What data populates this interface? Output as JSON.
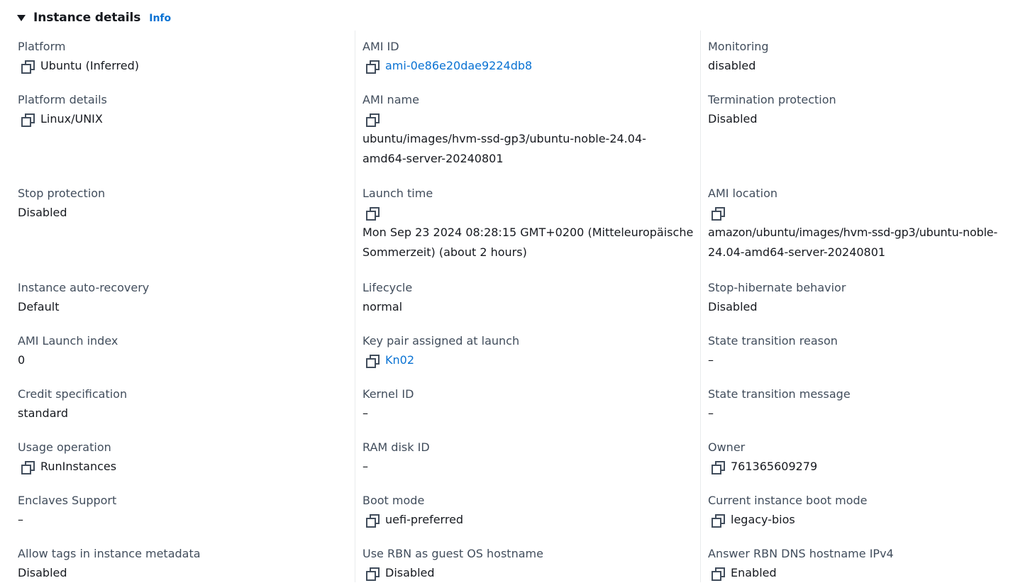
{
  "header": {
    "title": "Instance details",
    "info_link": "Info"
  },
  "col1": {
    "platform": {
      "label": "Platform",
      "value": "Ubuntu (Inferred)"
    },
    "platform_details": {
      "label": "Platform details",
      "value": "Linux/UNIX"
    },
    "stop_protection": {
      "label": "Stop protection",
      "value": "Disabled"
    },
    "auto_recovery": {
      "label": "Instance auto-recovery",
      "value": "Default"
    },
    "ami_launch_index": {
      "label": "AMI Launch index",
      "value": "0"
    },
    "credit_spec": {
      "label": "Credit specification",
      "value": "standard"
    },
    "usage_operation": {
      "label": "Usage operation",
      "value": "RunInstances"
    },
    "enclaves": {
      "label": "Enclaves Support",
      "value": "–"
    },
    "allow_tags": {
      "label": "Allow tags in instance metadata",
      "value": "Disabled"
    }
  },
  "col2": {
    "ami_id": {
      "label": "AMI ID",
      "value": "ami-0e86e20dae9224db8"
    },
    "ami_name": {
      "label": "AMI name",
      "line1": "ubuntu/images/hvm-ssd-gp3/ubuntu-noble-24.04-",
      "line2": "amd64-server-20240801"
    },
    "launch_time": {
      "label": "Launch time",
      "line1": "Mon Sep 23 2024 08:28:15 GMT+0200 (Mitteleuropäische",
      "line2": "Sommerzeit) (about 2 hours)"
    },
    "lifecycle": {
      "label": "Lifecycle",
      "value": "normal"
    },
    "key_pair": {
      "label": "Key pair assigned at launch",
      "value": "Kn02"
    },
    "kernel_id": {
      "label": "Kernel ID",
      "value": "–"
    },
    "ram_disk_id": {
      "label": "RAM disk ID",
      "value": "–"
    },
    "boot_mode": {
      "label": "Boot mode",
      "value": "uefi-preferred"
    },
    "rbn_hostname": {
      "label": "Use RBN as guest OS hostname",
      "value": "Disabled"
    }
  },
  "col3": {
    "monitoring": {
      "label": "Monitoring",
      "value": "disabled"
    },
    "termination_protection": {
      "label": "Termination protection",
      "value": "Disabled"
    },
    "ami_location": {
      "label": "AMI location",
      "line1": "amazon/ubuntu/images/hvm-ssd-gp3/ubuntu-noble-",
      "line2": "24.04-amd64-server-20240801"
    },
    "stop_hibernate": {
      "label": "Stop-hibernate behavior",
      "value": "Disabled"
    },
    "state_reason": {
      "label": "State transition reason",
      "value": "–"
    },
    "state_message": {
      "label": "State transition message",
      "value": "–"
    },
    "owner": {
      "label": "Owner",
      "value": "761365609279"
    },
    "current_boot_mode": {
      "label": "Current instance boot mode",
      "value": "legacy-bios"
    },
    "rbn_dns_ipv4": {
      "label": "Answer RBN DNS hostname IPv4",
      "value": "Enabled"
    }
  },
  "icons": {
    "expand": "caret-down-icon",
    "copy": "copy-icon"
  },
  "colors": {
    "link": "#0972d3",
    "label": "#414d5c",
    "text": "#16191f",
    "divider": "#e9ebed"
  }
}
